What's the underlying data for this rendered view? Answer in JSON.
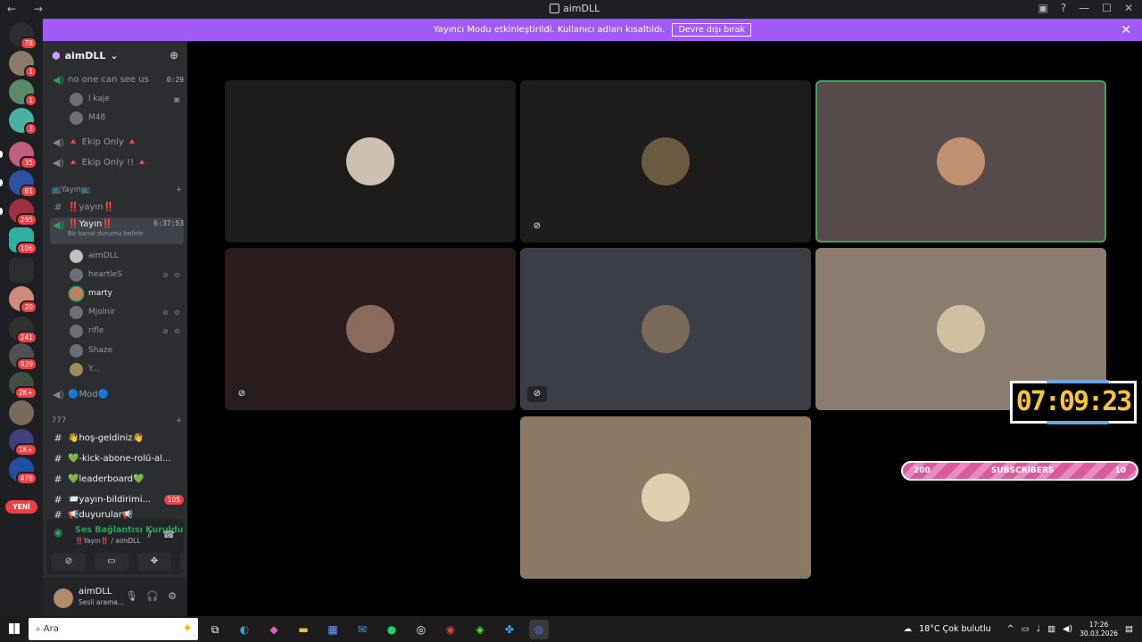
{
  "window": {
    "title": "aimDLL",
    "nav": "← →"
  },
  "banner": {
    "text": "Yayıncı Modu etkinleştirildi. Kullanıcı adları kısaltıldı.",
    "button": "Devre dışı bırak"
  },
  "servers": {
    "badges": [
      "78",
      "1",
      "1",
      "3",
      "35",
      "81",
      "295",
      "106",
      "20",
      "241",
      "939",
      "2K+",
      "1K+",
      "478"
    ],
    "new_label": "YENİ"
  },
  "guild": {
    "name": "aimDLL"
  },
  "channels": {
    "c1": {
      "name": "no one can see us",
      "time": "0:29"
    },
    "c1_users": [
      "l kaje",
      "M48"
    ],
    "c2": {
      "name": "🔺 Ekip Only 🔺"
    },
    "c3": {
      "name": "🔺 Ekip Only !! 🔺"
    },
    "cat1": "📺Yayın📺",
    "t1": "‼️yayın‼️",
    "v1": {
      "name": "‼️Yayın‼️",
      "time": "6:37:53",
      "status": "Bir kanal durumu belirle"
    },
    "v1_users": [
      {
        "name": "aimDLL",
        "st": ""
      },
      {
        "name": "heartleS",
        "st": "⊘ ⊘"
      },
      {
        "name": "marty",
        "st": ""
      },
      {
        "name": "Mjolnir",
        "st": "⊘ ⊘"
      },
      {
        "name": "rifle",
        "st": "⊘ ⊘"
      },
      {
        "name": "Shaze",
        "st": ""
      },
      {
        "name": "Y...",
        "st": ""
      }
    ],
    "mod": "🔵Mod🔵",
    "cat2": "777",
    "text_channels": [
      {
        "name": "👋hoş-geldiniz👋",
        "count": ""
      },
      {
        "name": "💚-kick-abone-rolü-al...",
        "count": ""
      },
      {
        "name": "💚leaderboard💚",
        "count": ""
      },
      {
        "name": "📨yayın-bildirimi...",
        "count": "105"
      },
      {
        "name": "📢duyurular📢",
        "count": ""
      }
    ]
  },
  "voice_panel": {
    "status": "Ses Bağlantısı Kuruldu",
    "location": "‼️Yayın‼️ / aimDLL"
  },
  "user_panel": {
    "name": "aimDLL",
    "status": "Sesli arama..."
  },
  "overlay": {
    "clock": "07:09:23",
    "subs_left": "200",
    "subs_label": "SUBSCRIBERS",
    "subs_right": "10"
  },
  "taskbar": {
    "search": "Ara",
    "weather": "18°C  Çok bulutlu",
    "time": "17:26",
    "date": "30.03.2026"
  },
  "colors": {
    "accent": "#a15af7",
    "speaking": "#3ba55c",
    "clock": "#f7c531"
  }
}
